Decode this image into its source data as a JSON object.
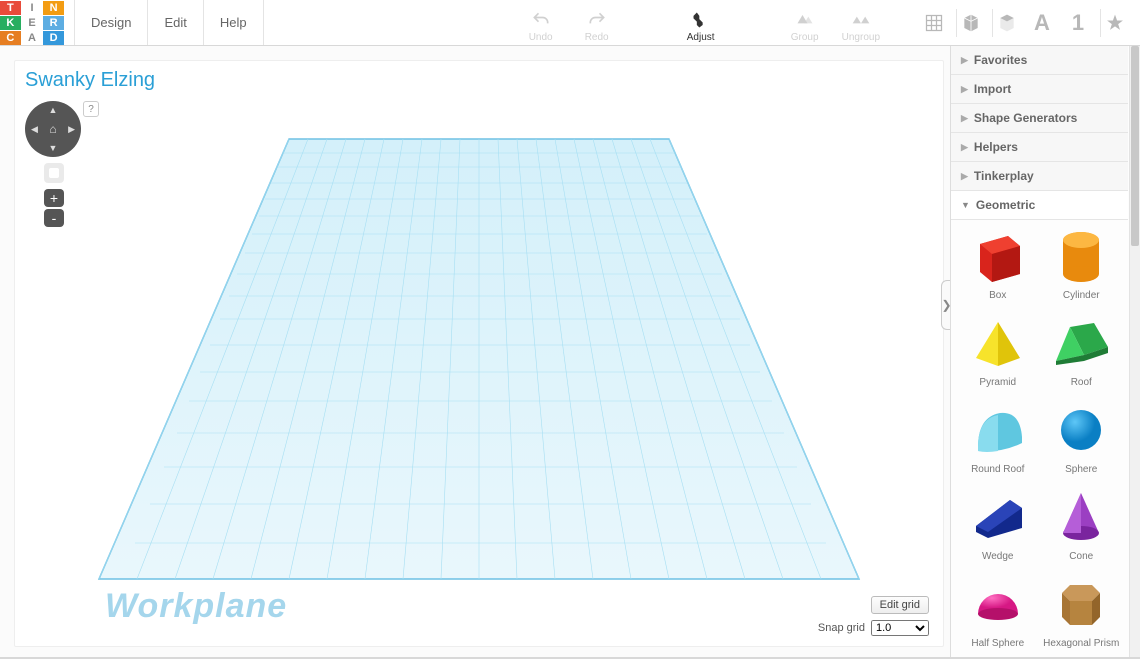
{
  "menus": {
    "design": "Design",
    "edit": "Edit",
    "help": "Help"
  },
  "project_title": "Swanky Elzing",
  "toolbar": {
    "undo": "Undo",
    "redo": "Redo",
    "adjust": "Adjust",
    "group": "Group",
    "ungroup": "Ungroup"
  },
  "right_icons": {
    "letter_a": "A",
    "number_1": "1"
  },
  "nav": {
    "help": "?",
    "zoom_in": "+",
    "zoom_out": "-"
  },
  "workplane_label": "Workplane",
  "edit_grid": "Edit grid",
  "snap_label": "Snap grid",
  "snap_value": "1.0",
  "side": {
    "categories": [
      "Favorites",
      "Import",
      "Shape Generators",
      "Helpers",
      "Tinkerplay",
      "Geometric"
    ],
    "shapes": [
      {
        "label": "Box"
      },
      {
        "label": "Cylinder"
      },
      {
        "label": "Pyramid"
      },
      {
        "label": "Roof"
      },
      {
        "label": "Round Roof"
      },
      {
        "label": "Sphere"
      },
      {
        "label": "Wedge"
      },
      {
        "label": "Cone"
      },
      {
        "label": "Half Sphere"
      },
      {
        "label": "Hexagonal Prism"
      }
    ]
  },
  "logo_letters": [
    "T",
    "I",
    "N",
    "K",
    "E",
    "R",
    "C",
    "A",
    "D"
  ],
  "logo_colors": [
    "#e84b3a",
    "#fff",
    "#f39c12",
    "#27ae60",
    "#fff",
    "#5dade2",
    "#e67e22",
    "#fff",
    "#3498db"
  ],
  "logo_fg": [
    "#fff",
    "#888",
    "#fff",
    "#fff",
    "#888",
    "#fff",
    "#fff",
    "#888",
    "#fff"
  ]
}
